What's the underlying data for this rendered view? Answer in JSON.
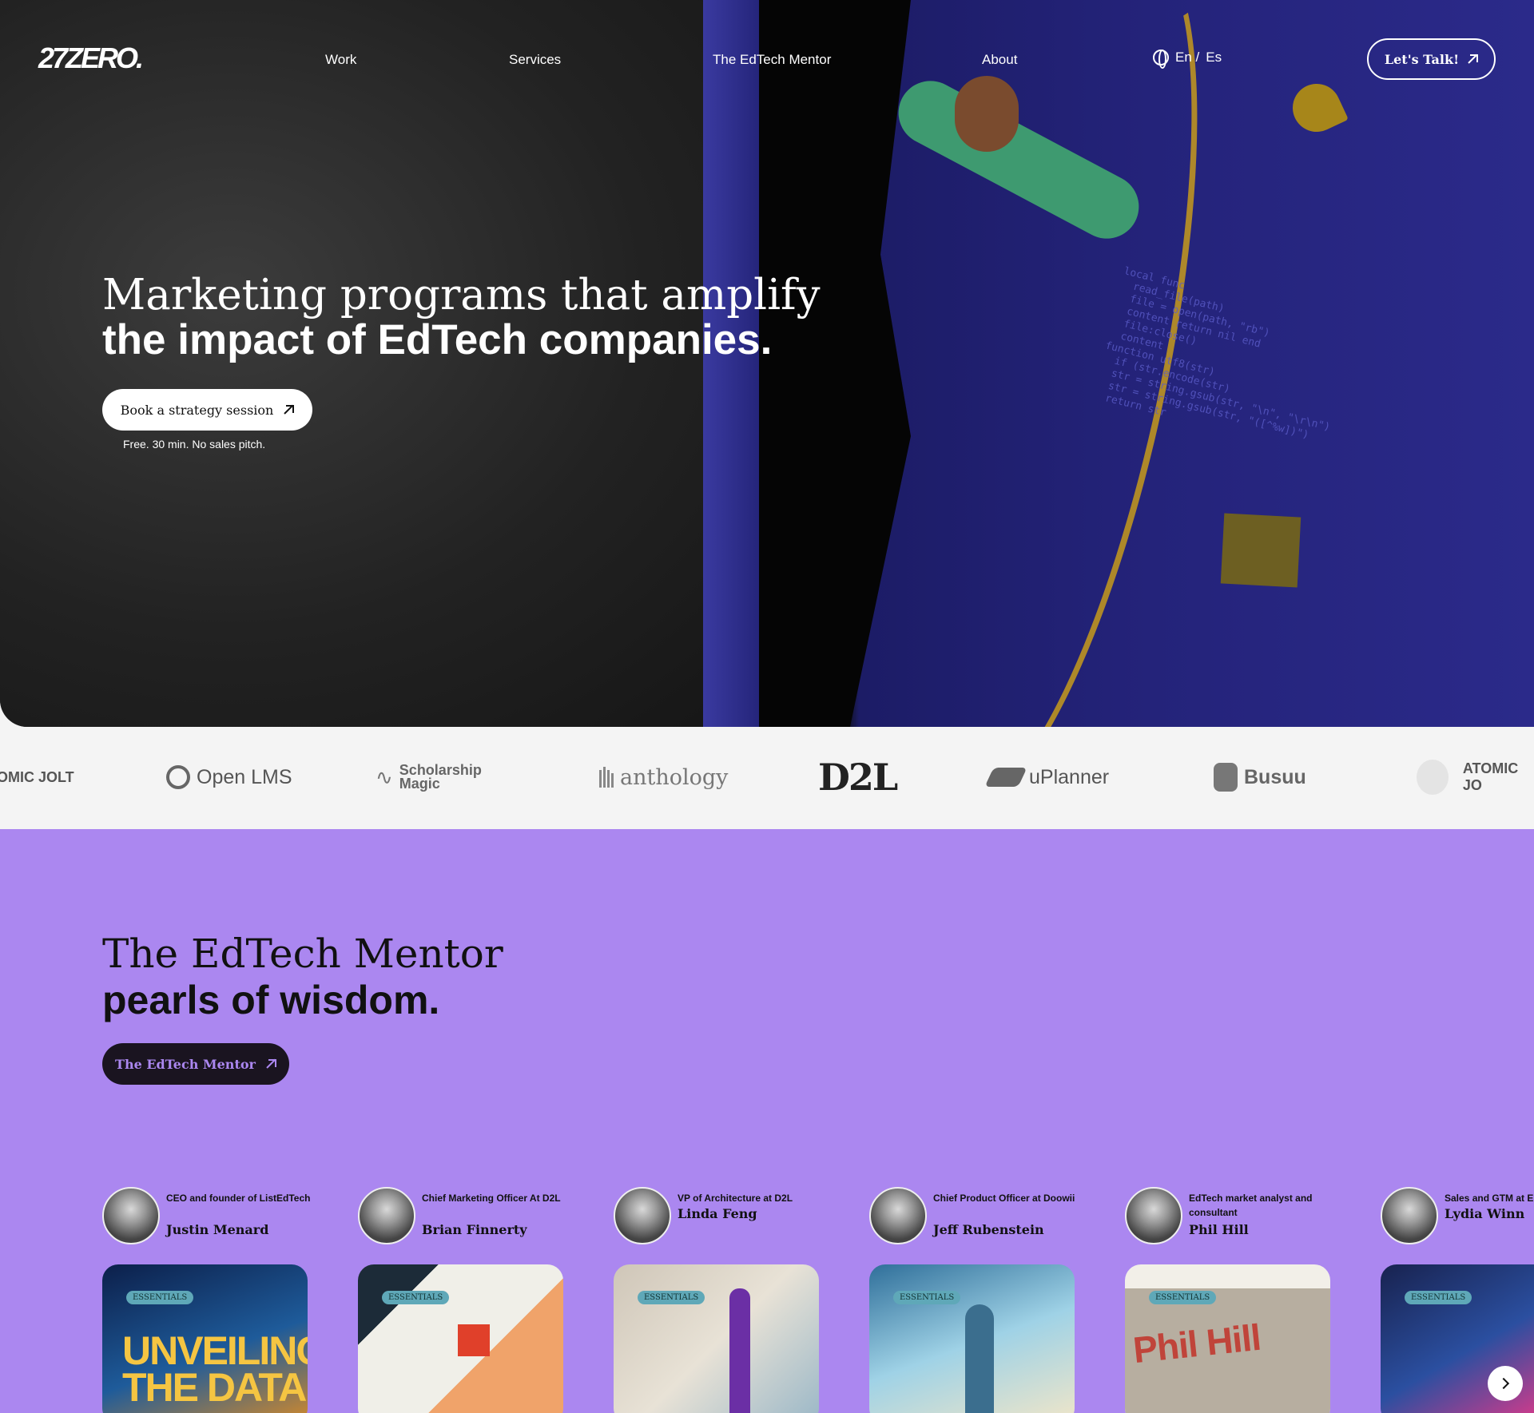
{
  "header": {
    "logo_text": "27ZERO.",
    "nav": [
      "Work",
      "Services",
      "The EdTech Mentor",
      "About"
    ],
    "lang_en": "En /",
    "lang_es": "Es",
    "cta": "Let's Talk!"
  },
  "hero": {
    "title_line1": "Marketing programs that amplify",
    "title_line2": "the impact of EdTech companies.",
    "button": "Book a strategy session",
    "note": "Free. 30 min. No sales pitch.",
    "code_text": "local func\n  read_file(path)\n  file = open(path, \"rb\")\n  content return nil end\n  file:close()\n  content\nfunction utf8(str)\n  if (str.encode(str)\n  str = string.gsub(str, \"\\n\", \"\\r\\n\")\n  str = string.gsub(str, \"([^%w])\")\n  return str"
  },
  "logos": {
    "atomic_jolt_left": "OMIC JOLT",
    "open_lms": "Open LMS",
    "scholarship_magic_1": "Scholarship",
    "scholarship_magic_2": "Magic",
    "anthology": "anthology",
    "d2l": "D2L",
    "uplanner": "uPlanner",
    "busuu": "Busuu",
    "atomic_jolt_right": "ATOMIC JO"
  },
  "mentor_section": {
    "title_line1": "The EdTech Mentor",
    "title_line2": "pearls of wisdom.",
    "button": "The EdTech Mentor",
    "tag": "ESSENTIALS",
    "mentors": [
      {
        "role": "CEO and founder of ListEdTech",
        "name": "Justin Menard",
        "card_text": "UNVEILING\nTHE DATA",
        "card_bg": "#1c3a7a"
      },
      {
        "role": "Chief Marketing Officer At D2L",
        "name": "Brian Finnerty",
        "card_text": "",
        "card_bg": "#e9e6e0"
      },
      {
        "role": "VP of Architecture at D2L",
        "name": "Linda Feng",
        "card_text": "",
        "card_bg": "#d9d2c6"
      },
      {
        "role": "Chief Product Officer at Doowii",
        "name": "Jeff Rubenstein",
        "card_text": "",
        "card_bg": "#7ab6d6"
      },
      {
        "role": "EdTech market analyst and consultant",
        "name": "Phil Hill",
        "card_text": "",
        "card_bg": "#f2efe8"
      },
      {
        "role": "Sales and GTM at E",
        "name": "Lydia Winn",
        "card_text": "",
        "card_bg": "#1f2d6b"
      }
    ]
  },
  "colors": {
    "hero_dark": "#1e1e1e",
    "hero_blue": "#24237a",
    "purple": "#ab87f0",
    "strip": "#f4f4f4"
  }
}
